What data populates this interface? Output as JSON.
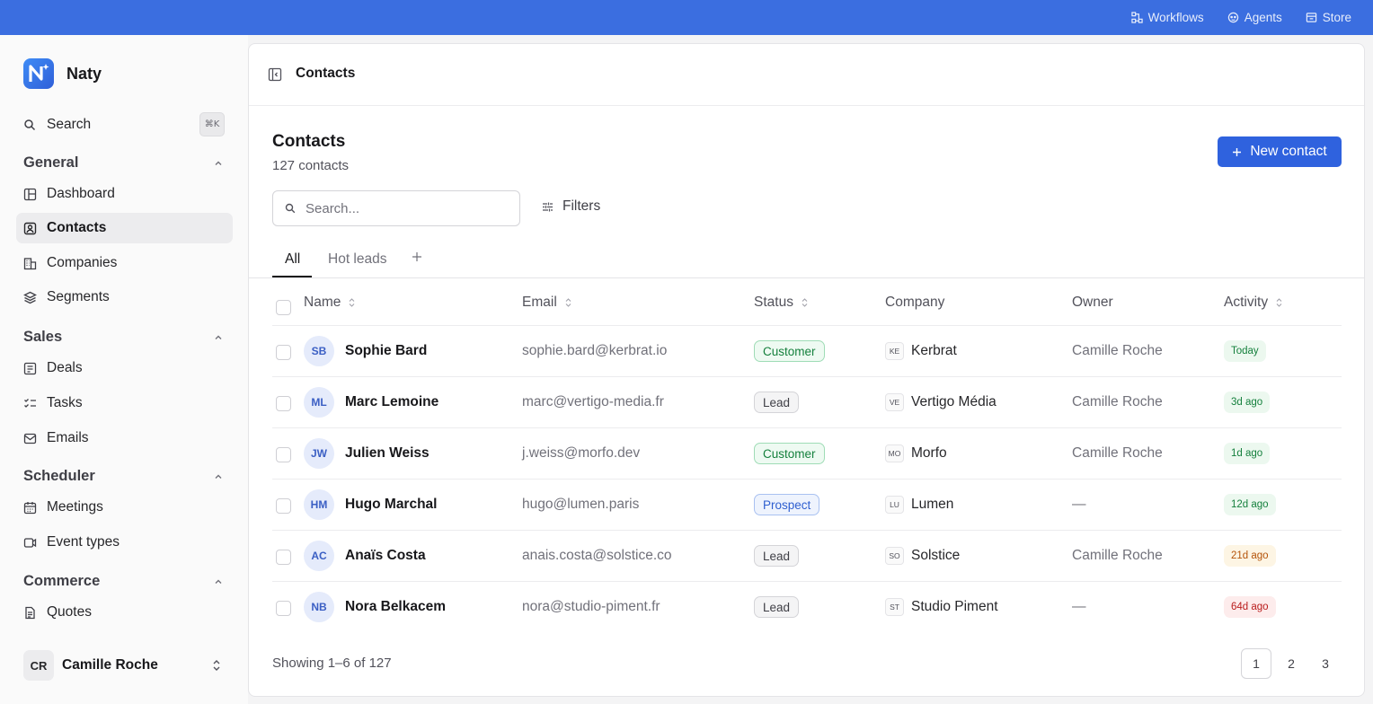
{
  "topbar": {
    "links": [
      {
        "label": "Workflows",
        "icon": "workflow-icon"
      },
      {
        "label": "Agents",
        "icon": "agent-icon"
      },
      {
        "label": "Store",
        "icon": "store-icon"
      }
    ]
  },
  "sidebar": {
    "brand": "Naty",
    "search": {
      "label": "Search",
      "shortcut": "⌘K"
    },
    "sections": [
      {
        "title": "General",
        "items": [
          {
            "label": "Dashboard",
            "icon": "dashboard-icon"
          },
          {
            "label": "Contacts",
            "icon": "contacts-icon",
            "active": true
          },
          {
            "label": "Companies",
            "icon": "building-icon"
          },
          {
            "label": "Segments",
            "icon": "layers-icon"
          }
        ]
      },
      {
        "title": "Sales",
        "items": [
          {
            "label": "Deals",
            "icon": "deals-icon"
          },
          {
            "label": "Tasks",
            "icon": "tasks-icon"
          },
          {
            "label": "Emails",
            "icon": "mail-icon"
          }
        ]
      },
      {
        "title": "Scheduler",
        "items": [
          {
            "label": "Meetings",
            "icon": "calendar-icon"
          },
          {
            "label": "Event types",
            "icon": "video-icon"
          }
        ]
      },
      {
        "title": "Commerce",
        "items": [
          {
            "label": "Quotes",
            "icon": "document-icon"
          }
        ]
      }
    ],
    "user": {
      "initials": "CR",
      "name": "Camille Roche"
    }
  },
  "header": {
    "title": "Contacts"
  },
  "page": {
    "title": "Contacts",
    "count": "127 contacts",
    "new_button": "New contact",
    "search_placeholder": "Search...",
    "filters_label": "Filters",
    "tabs": [
      "All",
      "Hot leads"
    ]
  },
  "table": {
    "columns": [
      "Name",
      "Email",
      "Status",
      "Company",
      "Owner",
      "Activity"
    ],
    "rows": [
      {
        "initials": "SB",
        "name": "Sophie Bard",
        "email": "sophie.bard@kerbrat.io",
        "status": "Customer",
        "company_code": "KE",
        "company": "Kerbrat",
        "owner": "Camille Roche",
        "activity": "Today"
      },
      {
        "initials": "ML",
        "name": "Marc Lemoine",
        "email": "marc@vertigo-media.fr",
        "status": "Lead",
        "company_code": "VE",
        "company": "Vertigo Média",
        "owner": "Camille Roche",
        "activity": "3d ago"
      },
      {
        "initials": "JW",
        "name": "Julien Weiss",
        "email": "j.weiss@morfo.dev",
        "status": "Customer",
        "company_code": "MO",
        "company": "Morfo",
        "owner": "Camille Roche",
        "activity": "1d ago"
      },
      {
        "initials": "HM",
        "name": "Hugo Marchal",
        "email": "hugo@lumen.paris",
        "status": "Prospect",
        "company_code": "LU",
        "company": "Lumen",
        "owner": "—",
        "activity": "12d ago"
      },
      {
        "initials": "AC",
        "name": "Anaïs Costa",
        "email": "anais.costa@solstice.co",
        "status": "Lead",
        "company_code": "SO",
        "company": "Solstice",
        "owner": "Camille Roche",
        "activity": "21d ago"
      },
      {
        "initials": "NB",
        "name": "Nora Belkacem",
        "email": "nora@studio-piment.fr",
        "status": "Lead",
        "company_code": "ST",
        "company": "Studio Piment",
        "owner": "—",
        "activity": "64d ago"
      }
    ]
  },
  "footer": {
    "showing": "Showing 1–6 of 127",
    "pages": [
      "1",
      "2",
      "3"
    ],
    "current_page": "1"
  },
  "colors": {
    "topbar": "#3b6ee0",
    "primary_button": "#2f62de",
    "status": {
      "Customer": {
        "bg": "#eefaf2",
        "border": "#9fdcb6",
        "text": "#15803d"
      },
      "Lead": {
        "bg": "#f4f4f5",
        "border": "#d4d4d8",
        "text": "#3f3f46"
      },
      "Prospect": {
        "bg": "#eef3fd",
        "border": "#a9c1f1",
        "text": "#2f5fd0"
      }
    },
    "activity": {
      "Today": {
        "bg": "#ecf8ef",
        "text": "#15803d"
      },
      "3d ago": {
        "bg": "#ecf8ef",
        "text": "#15803d"
      },
      "1d ago": {
        "bg": "#ecf8ef",
        "text": "#15803d"
      },
      "12d ago": {
        "bg": "#ecf8ef",
        "text": "#15803d"
      },
      "21d ago": {
        "bg": "#fdf5e4",
        "text": "#b45309"
      },
      "64d ago": {
        "bg": "#fdecec",
        "text": "#b91c1c"
      }
    }
  }
}
